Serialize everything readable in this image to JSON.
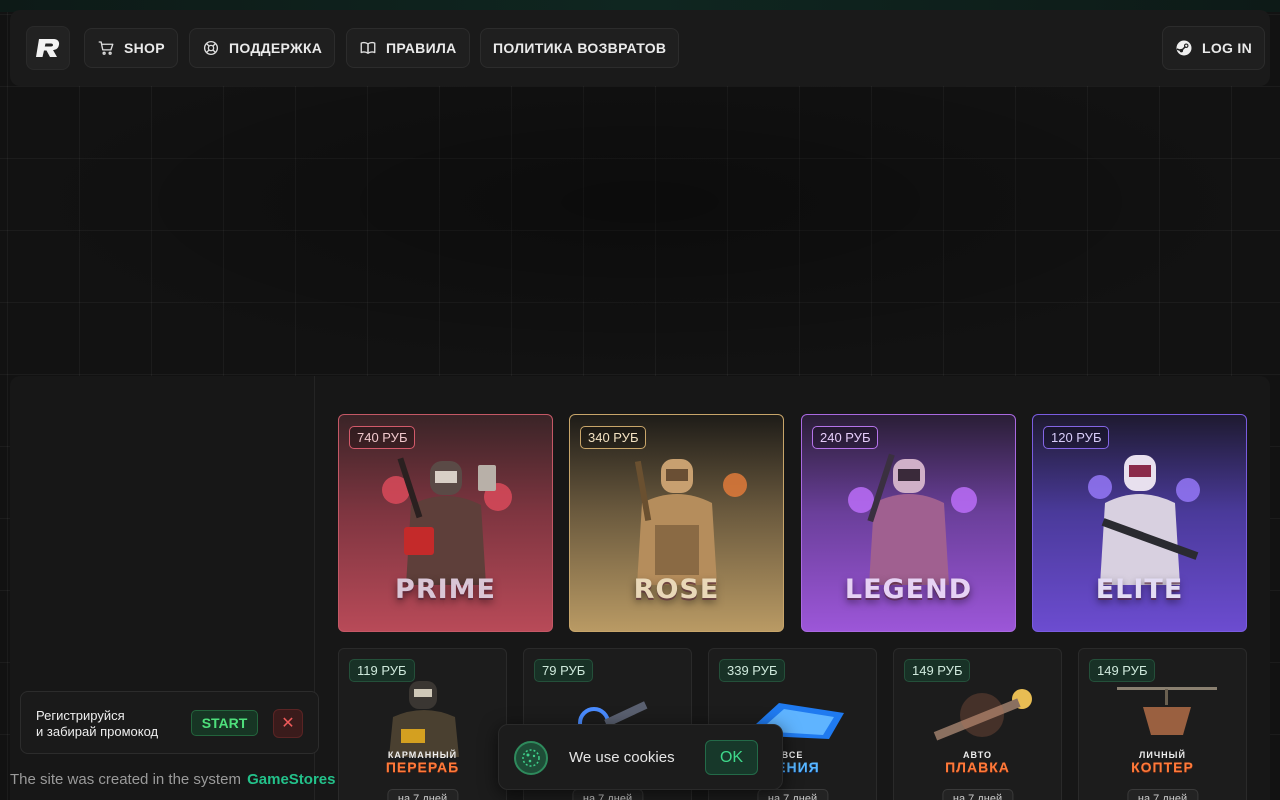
{
  "header": {
    "nav": [
      {
        "label": "SHOP",
        "icon": "cart-icon"
      },
      {
        "label": "ПОДДЕРЖКА",
        "icon": "lifebuoy-icon"
      },
      {
        "label": "ПРАВИЛА",
        "icon": "book-icon"
      },
      {
        "label": "ПОЛИТИКА ВОЗВРАТОВ"
      }
    ],
    "login_label": "LOG IN"
  },
  "privileges": [
    {
      "title": "PRIME",
      "price": "740 РУБ",
      "color": "#c24a5a"
    },
    {
      "title": "ROSE",
      "price": "340 РУБ",
      "color": "#b8925a"
    },
    {
      "title": "LEGEND",
      "price": "240 РУБ",
      "color": "#9a55d6"
    },
    {
      "title": "ELITE",
      "price": "120 РУБ",
      "color": "#6a48c8"
    }
  ],
  "products": [
    {
      "price": "119 РУБ",
      "line1": "КАРМАННЫЙ",
      "line2": "ПЕРЕРАБ",
      "duration": "на 7 дней"
    },
    {
      "price": "79 РУБ",
      "line1": "",
      "line2": "",
      "duration": "на 7 дней"
    },
    {
      "price": "339 РУБ",
      "line1": "ВСЕ",
      "line2": "ЧЕНИЯ",
      "duration": "на 7 дней"
    },
    {
      "price": "149 РУБ",
      "line1": "АВТО",
      "line2": "ПЛАВКА",
      "duration": "на 7 дней"
    },
    {
      "price": "149 РУБ",
      "line1": "ЛИЧНЫЙ",
      "line2": "КОПТЕР",
      "duration": "на 7 дней"
    }
  ],
  "promo": {
    "line1": "Регистрируйся",
    "line2": "и забирай промокод",
    "start_label": "START",
    "close_label": "✕"
  },
  "footer": {
    "text": "The site was created in the system",
    "brand": "GameStores"
  },
  "cookies": {
    "text": "We use cookies",
    "ok_label": "OK"
  },
  "colors": {
    "accent": "#23c18a",
    "background": "#121212",
    "panel": "#171717"
  }
}
